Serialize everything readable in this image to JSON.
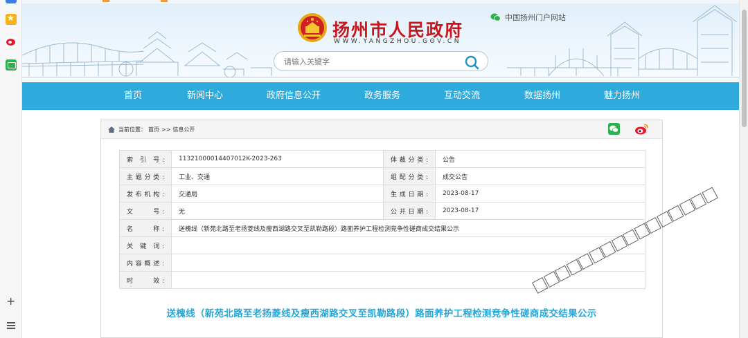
{
  "header": {
    "site_title": "扬州市人民政府",
    "site_url": "WWW.YANGZHOU.GOV.CN",
    "portal_link": "中国扬州门户网站",
    "search_placeholder": "请输入关键字"
  },
  "nav": {
    "items": [
      {
        "label": "首页"
      },
      {
        "label": "新闻中心"
      },
      {
        "label": "政府信息公开"
      },
      {
        "label": "政务服务"
      },
      {
        "label": "互动交流"
      },
      {
        "label": "数据扬州"
      },
      {
        "label": "魅力扬州"
      }
    ]
  },
  "breadcrumb": {
    "prefix": "当前位置：",
    "home": "首页",
    "separator": ">>",
    "current": "信息公开"
  },
  "meta": {
    "index_label": "索 引 号:",
    "index_value": "11321000014407012K-2023-263",
    "genre_label": "体裁分类:",
    "genre_value": "公告",
    "topic_label": "主题分类:",
    "topic_value": "工业、交通",
    "category_label": "组配分类:",
    "category_value": "成交公告",
    "publisher_label": "发布机构:",
    "publisher_value": "交通局",
    "created_label": "生成日期:",
    "created_value": "2023-08-17",
    "docno_label": "文　　号:",
    "docno_value": "无",
    "published_label": "公开日期:",
    "published_value": "2023-08-17",
    "name_label": "名　　称:",
    "name_value": "送槐线（新苑北路至老扬菱线及瘦西湖路交叉至凯勒路段）路面养护工程检测竞争性磋商成交结果公示",
    "keywords_label": "关 键 词:",
    "keywords_value": "",
    "summary_label": "内容概述:",
    "summary_value": "",
    "validity_label": "时　　效:",
    "validity_value": ""
  },
  "article": {
    "title": "送槐线（新苑北路至老扬菱线及瘦西湖路交叉至凯勒路段）路面养护工程检测竞争性磋商成交结果公示"
  },
  "colors": {
    "nav_bg": "#2eaadc",
    "title_red": "#c8161d",
    "article_title": "#27a6d8"
  }
}
